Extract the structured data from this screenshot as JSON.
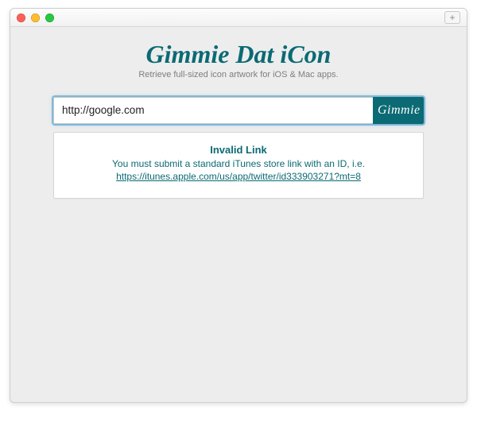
{
  "colors": {
    "accent": "#0b6a73",
    "window_bg": "#ededed",
    "focus_ring": "#7fb8d9"
  },
  "window": {
    "new_tab_glyph": "+"
  },
  "header": {
    "title": "Gimmie Dat iCon",
    "tagline": "Retrieve full-sized icon artwork for iOS & Mac apps."
  },
  "search": {
    "value": "http://google.com",
    "placeholder": "",
    "button_label": "Gimmie"
  },
  "result": {
    "error_title": "Invalid Link",
    "error_message": "You must submit a standard iTunes store link with an ID, i.e.",
    "example_link": "https://itunes.apple.com/us/app/twitter/id333903271?mt=8"
  }
}
